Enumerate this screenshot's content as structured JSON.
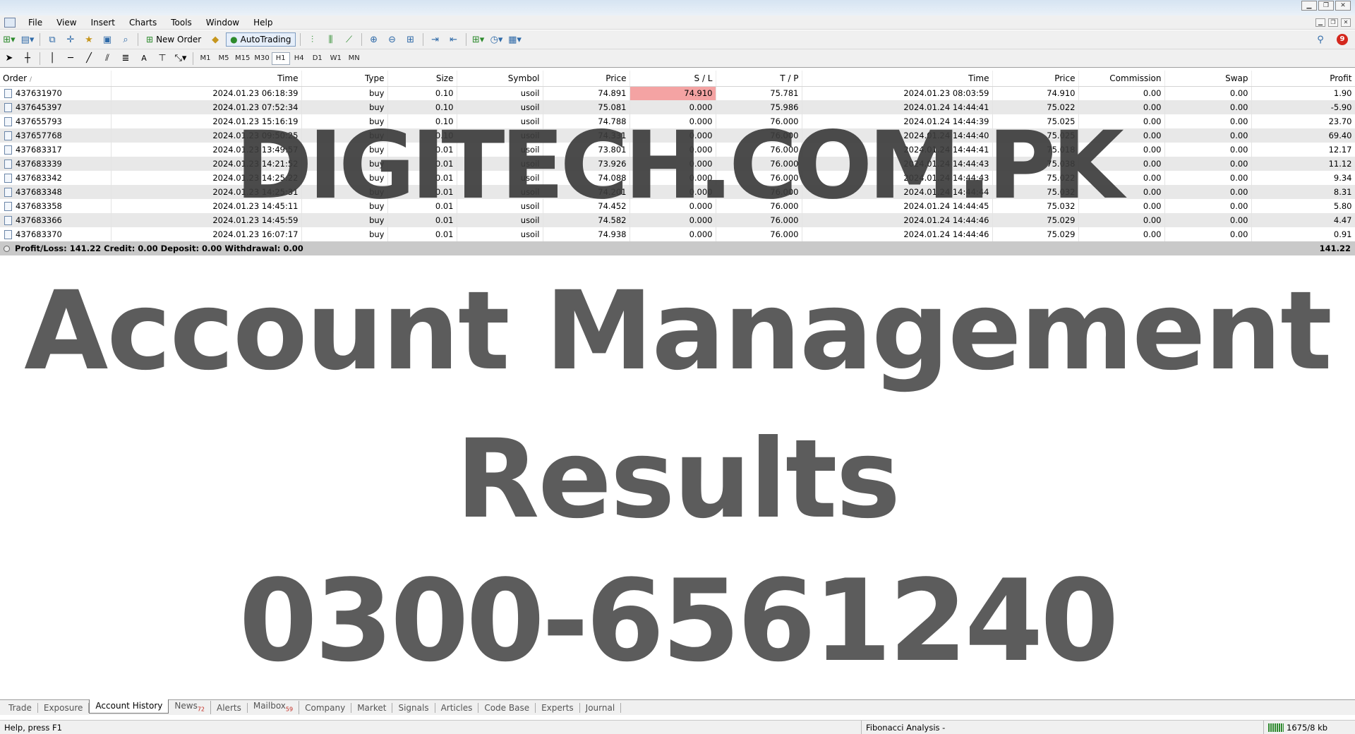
{
  "menu": [
    "File",
    "View",
    "Insert",
    "Charts",
    "Tools",
    "Window",
    "Help"
  ],
  "toolbar": {
    "new_order_label": "New Order",
    "autotrading_label": "AutoTrading",
    "notifications_count": "9"
  },
  "timeframes": [
    "M1",
    "M5",
    "M15",
    "M30",
    "H1",
    "H4",
    "D1",
    "W1",
    "MN"
  ],
  "table": {
    "headers": {
      "order": "Order",
      "sort_mark": "/",
      "time": "Time",
      "type": "Type",
      "size": "Size",
      "symbol": "Symbol",
      "price": "Price",
      "sl": "S / L",
      "tp": "T / P",
      "close_time": "Time",
      "close_price": "Price",
      "commission": "Commission",
      "swap": "Swap",
      "profit": "Profit"
    },
    "rows": [
      {
        "order": "437631970",
        "time": "2024.01.23 06:18:39",
        "type": "buy",
        "size": "0.10",
        "symbol": "usoil",
        "price": "74.891",
        "sl": "74.910",
        "tp": "75.781",
        "close_time": "2024.01.23 08:03:59",
        "close_price": "74.910",
        "commission": "0.00",
        "swap": "0.00",
        "profit": "1.90"
      },
      {
        "order": "437645397",
        "time": "2024.01.23 07:52:34",
        "type": "buy",
        "size": "0.10",
        "symbol": "usoil",
        "price": "75.081",
        "sl": "0.000",
        "tp": "75.986",
        "close_time": "2024.01.24 14:44:41",
        "close_price": "75.022",
        "commission": "0.00",
        "swap": "0.00",
        "profit": "-5.90"
      },
      {
        "order": "437655793",
        "time": "2024.01.23 15:16:19",
        "type": "buy",
        "size": "0.10",
        "symbol": "usoil",
        "price": "74.788",
        "sl": "0.000",
        "tp": "76.000",
        "close_time": "2024.01.24 14:44:39",
        "close_price": "75.025",
        "commission": "0.00",
        "swap": "0.00",
        "profit": "23.70"
      },
      {
        "order": "437657768",
        "time": "2024.01.23 09:50:25",
        "type": "buy",
        "size": "0.10",
        "symbol": "usoil",
        "price": "74.331",
        "sl": "0.000",
        "tp": "76.000",
        "close_time": "2024.01.24 14:44:40",
        "close_price": "75.025",
        "commission": "0.00",
        "swap": "0.00",
        "profit": "69.40"
      },
      {
        "order": "437683317",
        "time": "2024.01.23 13:49:57",
        "type": "buy",
        "size": "0.01",
        "symbol": "usoil",
        "price": "73.801",
        "sl": "0.000",
        "tp": "76.000",
        "close_time": "2024.01.24 14:44:41",
        "close_price": "75.018",
        "commission": "0.00",
        "swap": "0.00",
        "profit": "12.17"
      },
      {
        "order": "437683339",
        "time": "2024.01.23 14:21:52",
        "type": "buy",
        "size": "0.01",
        "symbol": "usoil",
        "price": "73.926",
        "sl": "0.000",
        "tp": "76.000",
        "close_time": "2024.01.24 14:44:43",
        "close_price": "75.038",
        "commission": "0.00",
        "swap": "0.00",
        "profit": "11.12"
      },
      {
        "order": "437683342",
        "time": "2024.01.23 14:25:22",
        "type": "buy",
        "size": "0.01",
        "symbol": "usoil",
        "price": "74.088",
        "sl": "0.000",
        "tp": "76.000",
        "close_time": "2024.01.24 14:44:43",
        "close_price": "75.022",
        "commission": "0.00",
        "swap": "0.00",
        "profit": "9.34"
      },
      {
        "order": "437683348",
        "time": "2024.01.23 14:25:31",
        "type": "buy",
        "size": "0.01",
        "symbol": "usoil",
        "price": "74.201",
        "sl": "0.000",
        "tp": "76.000",
        "close_time": "2024.01.24 14:44:44",
        "close_price": "75.032",
        "commission": "0.00",
        "swap": "0.00",
        "profit": "8.31"
      },
      {
        "order": "437683358",
        "time": "2024.01.23 14:45:11",
        "type": "buy",
        "size": "0.01",
        "symbol": "usoil",
        "price": "74.452",
        "sl": "0.000",
        "tp": "76.000",
        "close_time": "2024.01.24 14:44:45",
        "close_price": "75.032",
        "commission": "0.00",
        "swap": "0.00",
        "profit": "5.80"
      },
      {
        "order": "437683366",
        "time": "2024.01.23 14:45:59",
        "type": "buy",
        "size": "0.01",
        "symbol": "usoil",
        "price": "74.582",
        "sl": "0.000",
        "tp": "76.000",
        "close_time": "2024.01.24 14:44:46",
        "close_price": "75.029",
        "commission": "0.00",
        "swap": "0.00",
        "profit": "4.47"
      },
      {
        "order": "437683370",
        "time": "2024.01.23 16:07:17",
        "type": "buy",
        "size": "0.01",
        "symbol": "usoil",
        "price": "74.938",
        "sl": "0.000",
        "tp": "76.000",
        "close_time": "2024.01.24 14:44:46",
        "close_price": "75.029",
        "commission": "0.00",
        "swap": "0.00",
        "profit": "0.91"
      }
    ],
    "summary": "Profit/Loss: 141.22  Credit: 0.00  Deposit: 0.00  Withdrawal: 0.00",
    "summary_total": "141.22"
  },
  "watermark": {
    "line1": "DIGITECH.COM.PK",
    "line2": "Account Management",
    "line3": "Results",
    "line4": "0300-6561240"
  },
  "tabs": [
    {
      "label": "Trade",
      "badge": ""
    },
    {
      "label": "Exposure",
      "badge": ""
    },
    {
      "label": "Account History",
      "badge": "",
      "active": true
    },
    {
      "label": "News",
      "badge": "72"
    },
    {
      "label": "Alerts",
      "badge": ""
    },
    {
      "label": "Mailbox",
      "badge": "59"
    },
    {
      "label": "Company",
      "badge": ""
    },
    {
      "label": "Market",
      "badge": ""
    },
    {
      "label": "Signals",
      "badge": ""
    },
    {
      "label": "Articles",
      "badge": ""
    },
    {
      "label": "Code Base",
      "badge": ""
    },
    {
      "label": "Experts",
      "badge": ""
    },
    {
      "label": "Journal",
      "badge": ""
    }
  ],
  "status": {
    "help": "Help, press F1",
    "fibonacci": "Fibonacci Analysis -",
    "traffic": "1675/8 kb"
  },
  "colors": {
    "sl_hit": "#f4a3a3",
    "summary_bar": "#c9c9c9",
    "watermark": "#5c5c5c"
  }
}
